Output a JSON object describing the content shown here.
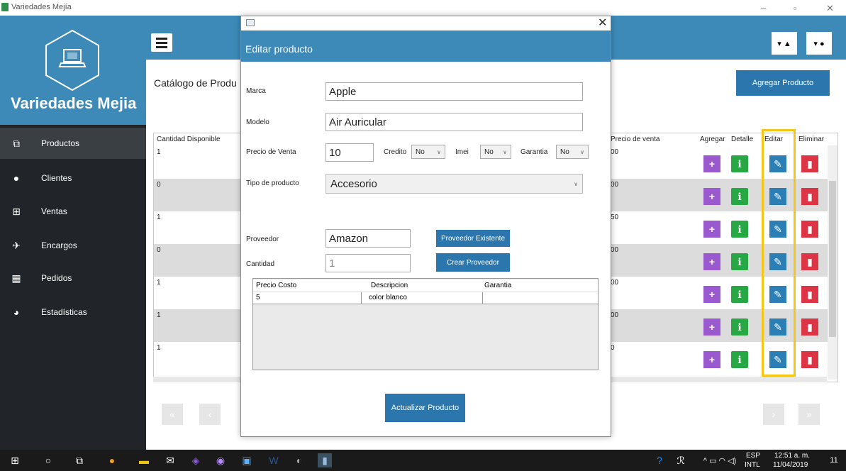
{
  "window": {
    "title": "Variedades Mejía",
    "min": "–",
    "max": "▫",
    "close": "✕"
  },
  "sidebar": {
    "brand": "Variedades Mejia",
    "items": [
      {
        "label": "Productos",
        "icon": "boxes-icon"
      },
      {
        "label": "Clientes",
        "icon": "user-icon"
      },
      {
        "label": "Ventas",
        "icon": "cart-icon"
      },
      {
        "label": "Encargos",
        "icon": "plane-icon"
      },
      {
        "label": "Pedidos",
        "icon": "dolly-icon"
      },
      {
        "label": "Estadísticas",
        "icon": "pie-chart-icon"
      }
    ]
  },
  "main": {
    "catalog_title": "Catálogo de Produ",
    "add_button": "Agregar Producto",
    "columns": {
      "qty": "Cantidad Disponible",
      "price": "Precio de venta",
      "agregar": "Agregar",
      "detalle": "Detalle",
      "editar": "Editar",
      "eliminar": "Eliminar"
    },
    "rows": [
      {
        "qty": "1",
        "price": "00"
      },
      {
        "qty": "0",
        "price": "00"
      },
      {
        "qty": "1",
        "price": "50"
      },
      {
        "qty": "0",
        "price": "00"
      },
      {
        "qty": "1",
        "price": "00"
      },
      {
        "qty": "1",
        "price": "00"
      },
      {
        "qty": "1",
        "price": "0"
      }
    ],
    "pager": {
      "first": "«",
      "prev": "‹",
      "next": "›",
      "last": "»"
    }
  },
  "modal": {
    "title": "Editar producto",
    "close": "✕",
    "marca_label": "Marca",
    "marca_value": "Apple",
    "modelo_label": "Modelo",
    "modelo_value": "Air Auricular",
    "precio_label": "Precio de Venta",
    "precio_value": "10",
    "credito_label": "Credito",
    "credito_value": "No",
    "imei_label": "Imei",
    "imei_value": "No",
    "garantia_label": "Garantia",
    "garantia_value": "No",
    "tipo_label": "Tipo de producto",
    "tipo_value": "Accesorio",
    "proveedor_label": "Proveedor",
    "proveedor_value": "Amazon",
    "proveedor_existente_btn": "Proveedor Existente",
    "cantidad_label": "Cantidad",
    "cantidad_value": "1",
    "crear_proveedor_btn": "Crear Proveedor",
    "grid": {
      "headers": [
        "Precio Costo",
        "Descripcion",
        "Garantia"
      ],
      "rows": [
        [
          "5",
          "color blanco",
          ""
        ]
      ]
    },
    "update_btn": "Actualizar Producto"
  },
  "taskbar": {
    "lang": "ESP",
    "layout": "INTL",
    "time": "12:51 a. m.",
    "date": "11/04/2019",
    "notif_count": "11"
  }
}
